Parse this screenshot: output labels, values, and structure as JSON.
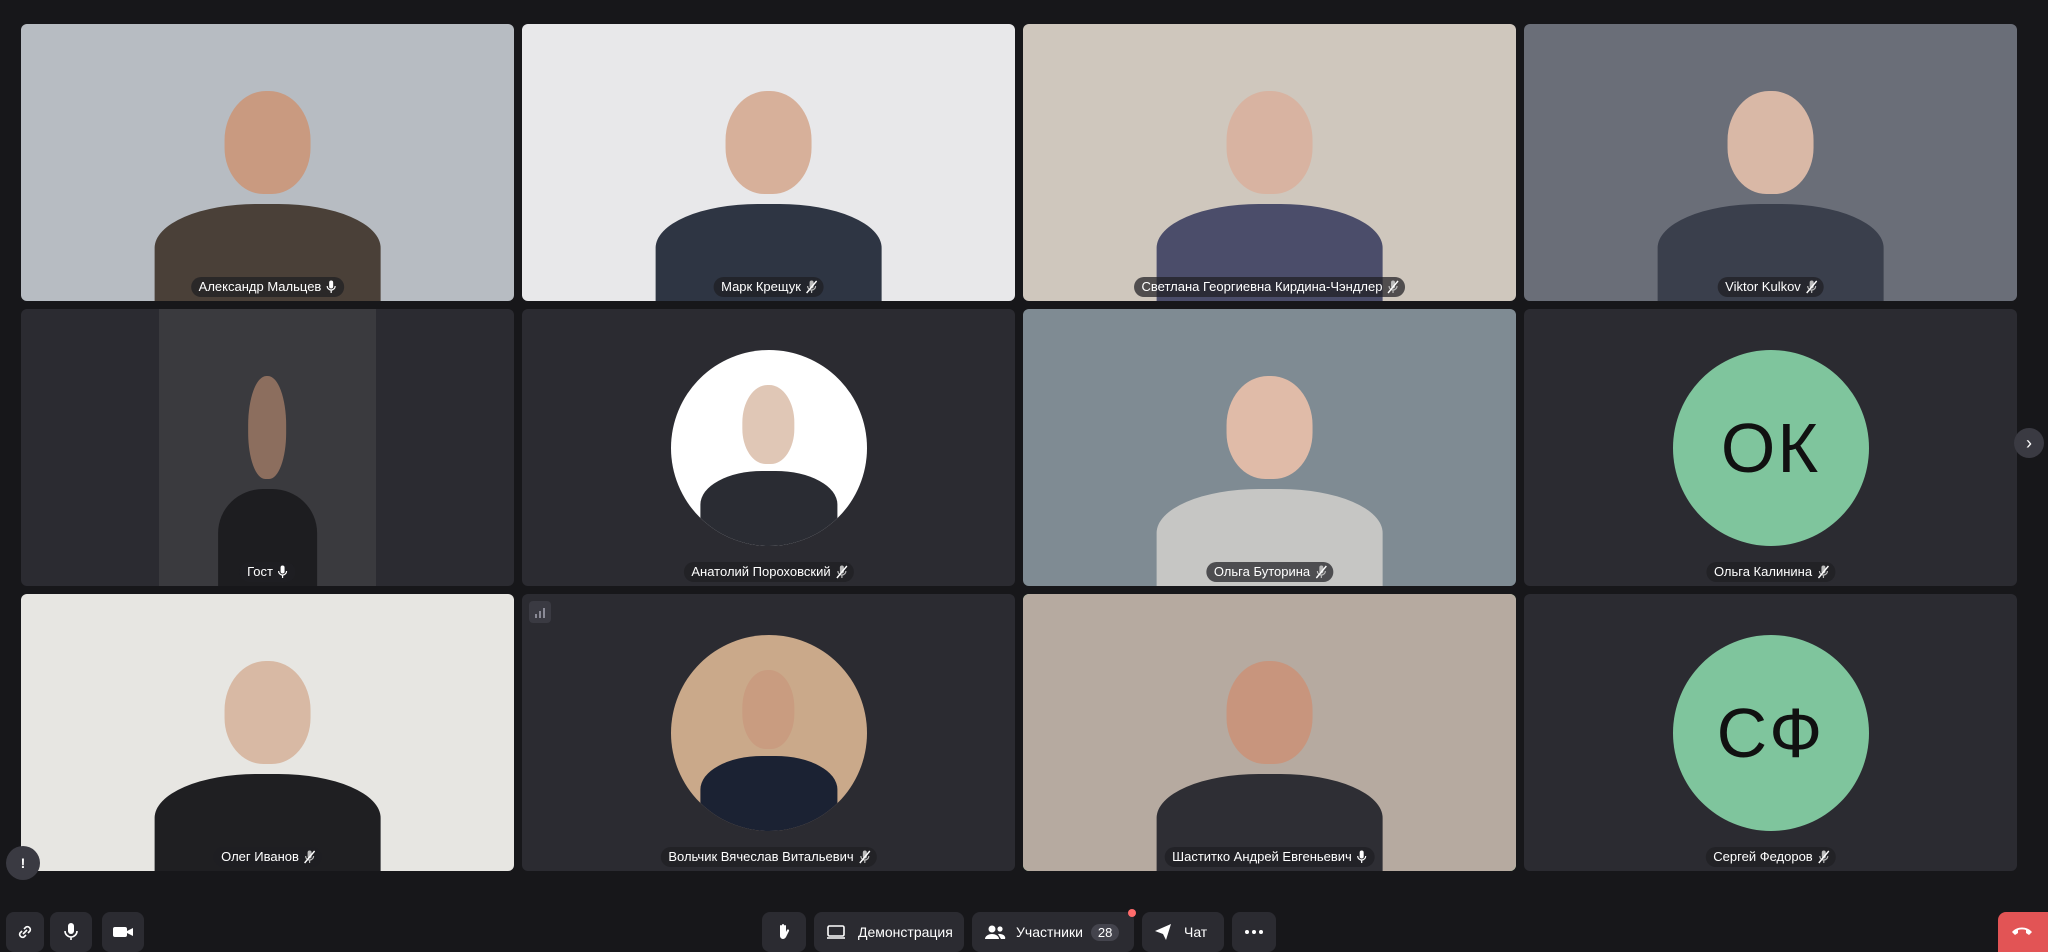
{
  "participants": [
    {
      "name": "Александр Мальцев",
      "mic": "on",
      "kind": "video",
      "bg": "#b7bcc2",
      "skin": "#c99a80",
      "shirt": "#4a4038"
    },
    {
      "name": "Марк Крещук",
      "mic": "off",
      "kind": "video",
      "bg": "#e8e8ea",
      "skin": "#d7b09a",
      "shirt": "#2e3543"
    },
    {
      "name": "Светлана Георгиевна Кирдина-Чэндлер",
      "mic": "off",
      "kind": "video",
      "bg": "#cfc7bd",
      "skin": "#d8b3a1",
      "shirt": "#4b4d6a"
    },
    {
      "name": "Viktor Kulkov",
      "mic": "off",
      "kind": "video",
      "bg": "#6a6e78",
      "skin": "#d9b8a6",
      "shirt": "#3a3f4c"
    },
    {
      "name": "Гост",
      "mic": "on",
      "kind": "video-narrow",
      "bg": "#3a3a3e",
      "skin": "#8c6e5e",
      "shirt": "#1d1d20"
    },
    {
      "name": "Анатолий Пороховский",
      "mic": "off",
      "kind": "avatar-photo",
      "bg": "#ffffff",
      "skin": "#e0c7b6",
      "shirt": "#2a2c33"
    },
    {
      "name": "Ольга Буторина",
      "mic": "off",
      "kind": "video",
      "bg": "#7f8b93",
      "skin": "#e0bba8",
      "shirt": "#c6c6c4"
    },
    {
      "name": "Ольга Калинина",
      "mic": "off",
      "kind": "initials",
      "initials": "ОК"
    },
    {
      "name": "Олег Иванов",
      "mic": "off",
      "kind": "video",
      "bg": "#e7e6e2",
      "skin": "#d8b9a4",
      "shirt": "#1f1f22"
    },
    {
      "name": "Вольчик Вячеслав Витальевич",
      "mic": "off",
      "kind": "avatar-photo",
      "bg": "#caa98a",
      "skin": "#c99c80",
      "shirt": "#1b2233",
      "signal": true
    },
    {
      "name": "Шаститко Андрей Евгеньевич",
      "mic": "on",
      "kind": "video",
      "bg": "#b6aaa0",
      "skin": "#c8957d",
      "shirt": "#2e2e34",
      "speaking": true
    },
    {
      "name": "Сергей Федоров",
      "mic": "off",
      "kind": "initials",
      "initials": "СФ"
    }
  ],
  "toolbar": {
    "demo_label": "Демонстрация",
    "participants_label": "Участники",
    "participants_count": "28",
    "chat_label": "Чат"
  },
  "icons": {
    "link": "link-icon",
    "mic": "microphone-icon",
    "camera": "camera-icon",
    "hand": "raise-hand-icon",
    "screen": "screen-share-icon",
    "people": "participants-icon",
    "chat": "chat-icon",
    "more": "more-icon",
    "end": "end-call-icon",
    "next": "chevron-right-icon",
    "feedback": "feedback-icon"
  },
  "colors": {
    "speaking": "#7ee08c",
    "initials_bg": "#7fc59d",
    "end_call": "#e25455"
  }
}
